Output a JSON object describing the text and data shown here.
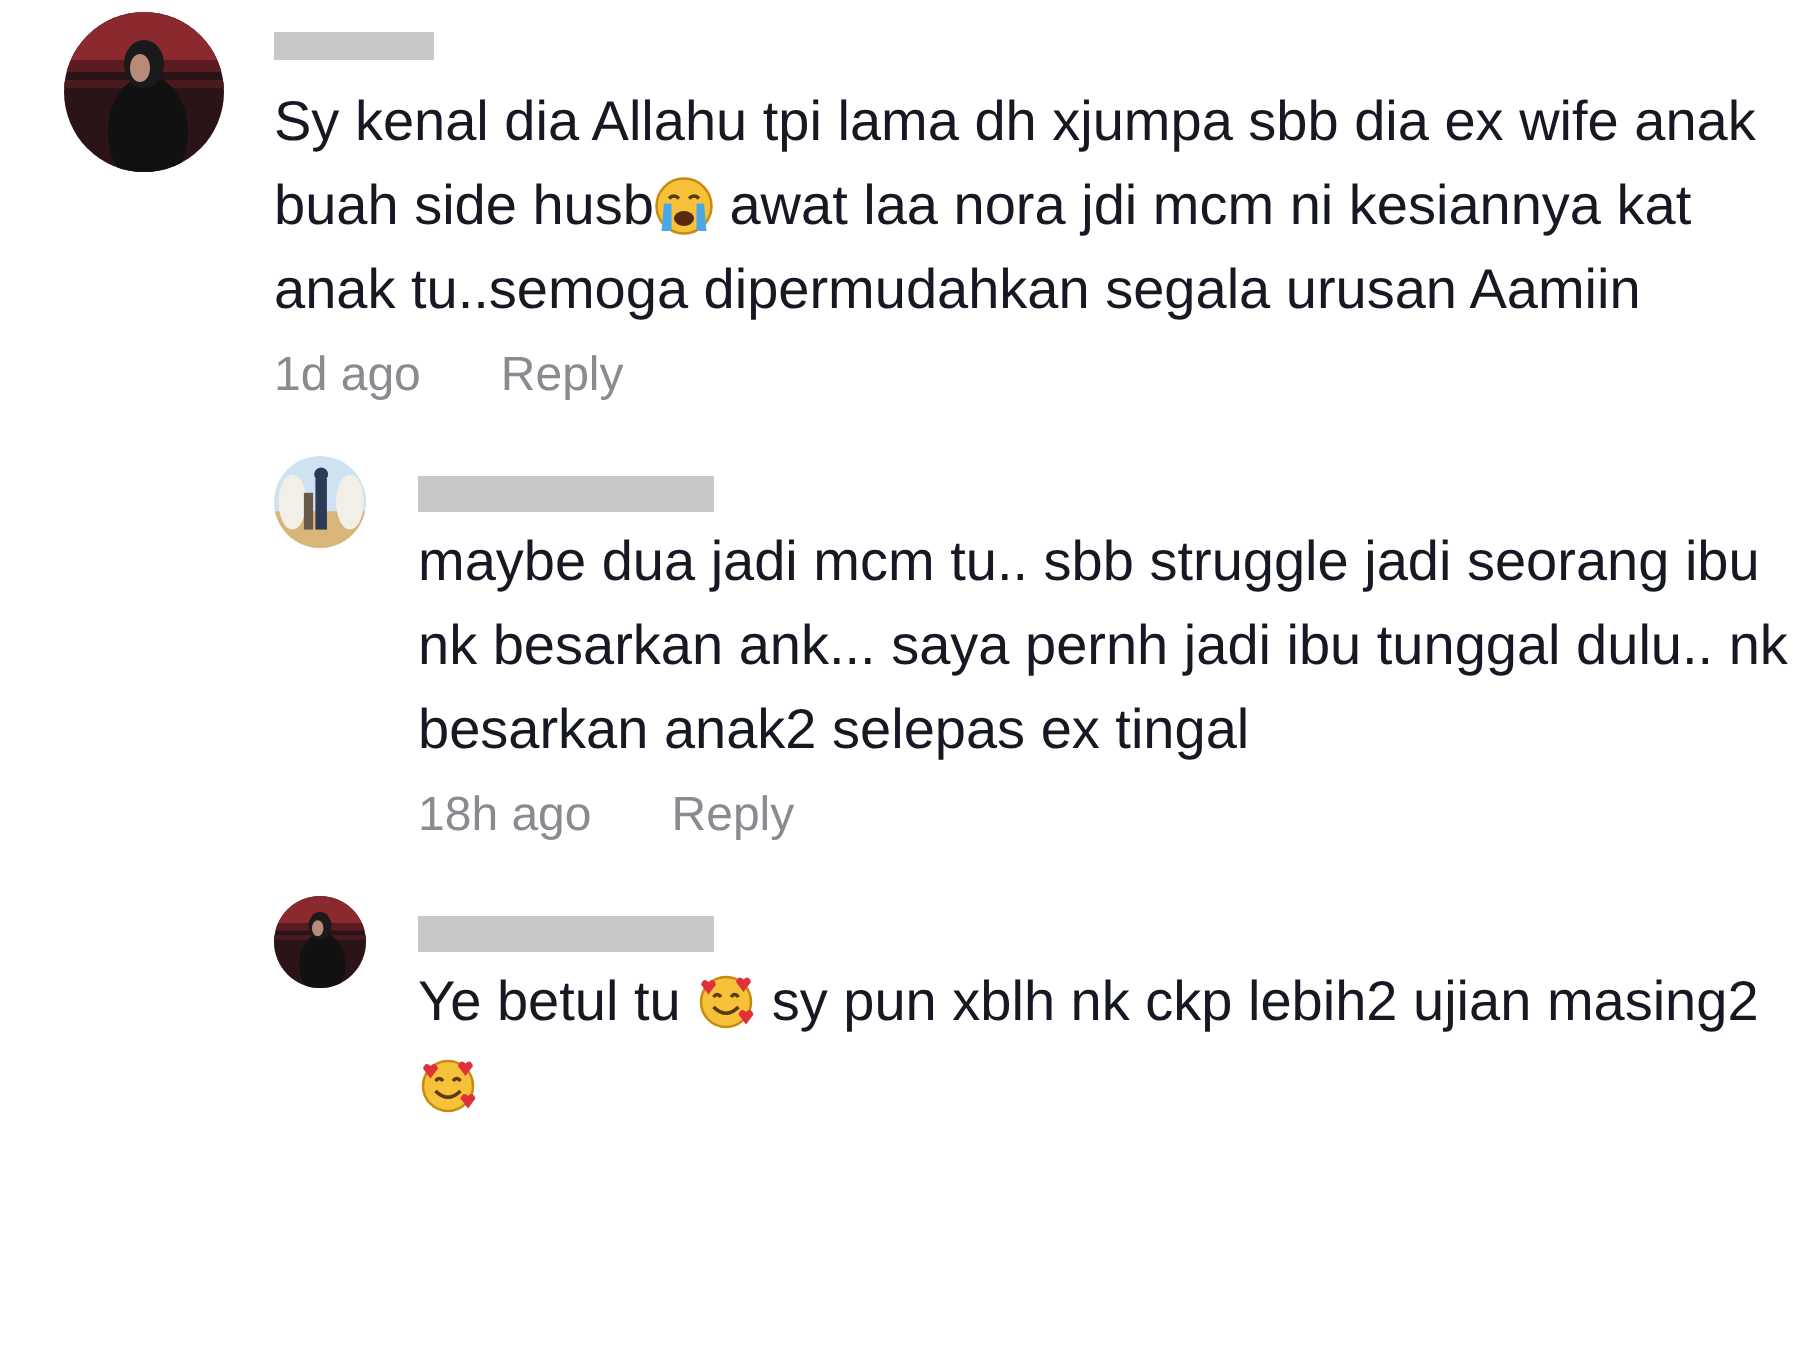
{
  "comments": [
    {
      "avatar": {
        "kind": "picture"
      },
      "segments": [
        {
          "kind": "text",
          "text": "Sy kenal dia Allahu tpi lama dh xjumpa sbb dia ex wife anak buah side husb"
        },
        {
          "kind": "crying"
        },
        {
          "kind": "text",
          "text": " awat laa nora jdi mcm ni kesiannya kat anak tu..semoga dipermudahkan segala urusan Aamiin"
        }
      ],
      "time": "1d ago",
      "reply_label": "Reply",
      "replies": [
        {
          "avatar": {
            "kind": "picture"
          },
          "segments": [
            {
              "kind": "text",
              "text": "maybe dua jadi mcm tu.. sbb struggle jadi seorang ibu nk besarkan ank... saya pernh jadi ibu tunggal dulu.. nk besarkan anak2 selepas ex tingal"
            }
          ],
          "time": "18h ago",
          "reply_label": "Reply"
        },
        {
          "avatar": {
            "kind": "picture"
          },
          "segments": [
            {
              "kind": "text",
              "text": "Ye betul tu "
            },
            {
              "kind": "hearts"
            },
            {
              "kind": "text",
              "text": " sy pun xblh nk ckp lebih2 ujian masing2 "
            },
            {
              "kind": "hearts"
            }
          ]
        }
      ]
    }
  ]
}
